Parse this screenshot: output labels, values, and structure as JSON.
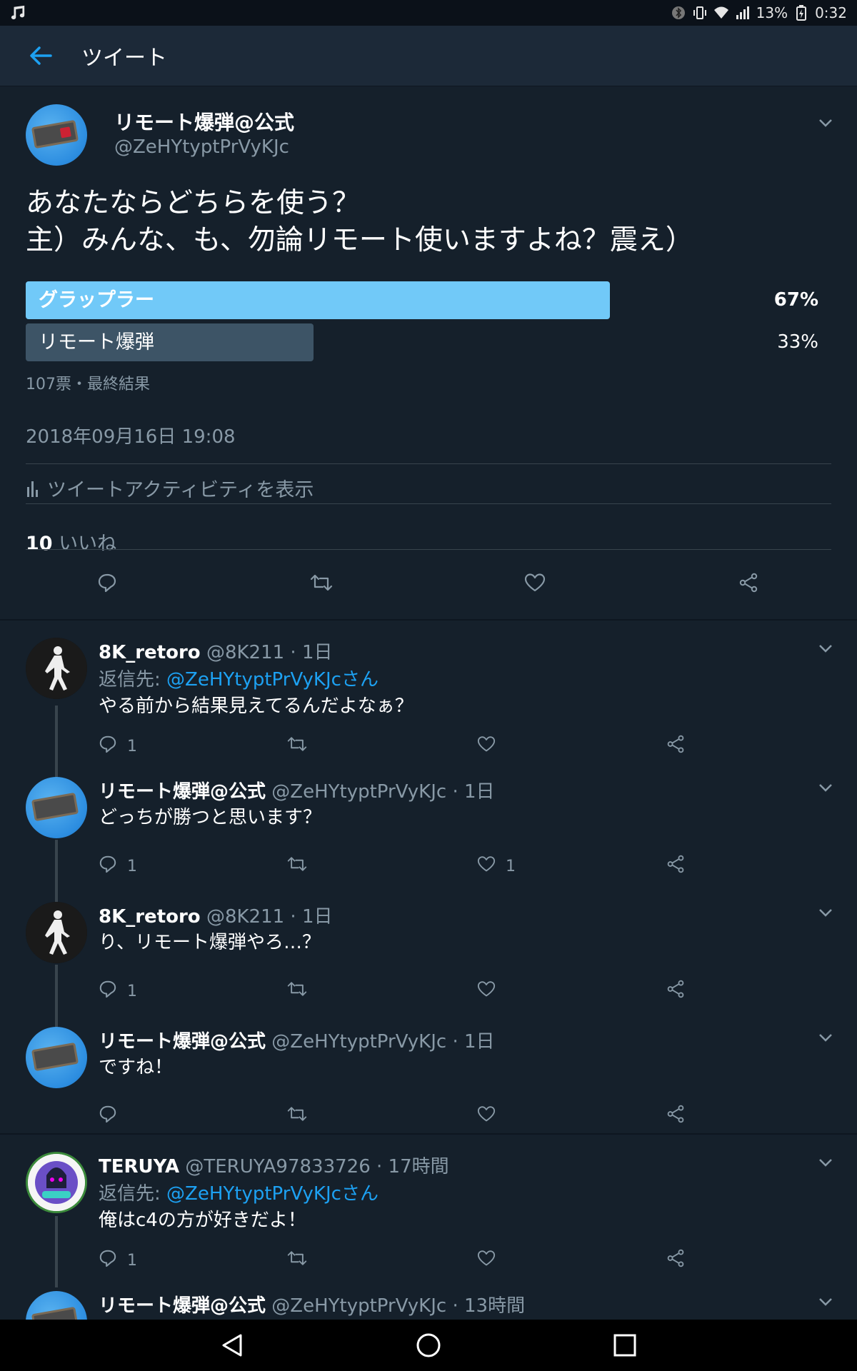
{
  "status_bar": {
    "battery": "13%",
    "time": "0:32"
  },
  "app_bar": {
    "title": "ツイート"
  },
  "tweet": {
    "author_name": "リモート爆弾@公式",
    "author_handle": "@ZeHYtyptPrVyKJc",
    "text_line1": "あなたならどちらを使う？",
    "text_line2": "主）みんな、も、勿論リモート使いますよね？震え）",
    "poll": {
      "options": [
        {
          "label": "グラップラー",
          "percent": "67%",
          "fraction": 0.67,
          "color": "#71c9f8"
        },
        {
          "label": "リモート爆弾",
          "percent": "33%",
          "fraction": 0.33,
          "color": "#3d5466"
        }
      ],
      "summary": "107票・最終結果"
    },
    "timestamp": "2018年09月16日 19:08",
    "activity_label": "ツイートアクティビティを表示",
    "likes_count": "10",
    "likes_label": "いいね"
  },
  "replies": [
    {
      "name": "8K_retoro",
      "handle": "@8K211 · 1日",
      "reply_to_label": "返信先:",
      "reply_to": "@ZeHYtyptPrVyKJcさん",
      "text": "やる前から結果見えてるんだよなぁ？",
      "reply_count": "1",
      "like_count": ""
    },
    {
      "name": "リモート爆弾@公式",
      "handle": "@ZeHYtyptPrVyKJc · 1日",
      "text": "どっちが勝つと思います？",
      "reply_count": "1",
      "like_count": "1"
    },
    {
      "name": "8K_retoro",
      "handle": "@8K211 · 1日",
      "text": "り、リモート爆弾やろ…？",
      "reply_count": "1",
      "like_count": ""
    },
    {
      "name": "リモート爆弾@公式",
      "handle": "@ZeHYtyptPrVyKJc · 1日",
      "text": "ですね！",
      "reply_count": "",
      "like_count": ""
    },
    {
      "name": "TERUYA",
      "handle": "@TERUYA97833726 · 17時間",
      "reply_to_label": "返信先:",
      "reply_to": "@ZeHYtyptPrVyKJcさん",
      "text": "俺はc4の方が好きだよ！",
      "reply_count": "1",
      "like_count": ""
    },
    {
      "name": "リモート爆弾@公式",
      "handle": "@ZeHYtyptPrVyKJc · 13時間"
    }
  ],
  "colors": {
    "background": "#15202b",
    "accent": "#1da1f2",
    "secondary_text": "#8899a6"
  }
}
